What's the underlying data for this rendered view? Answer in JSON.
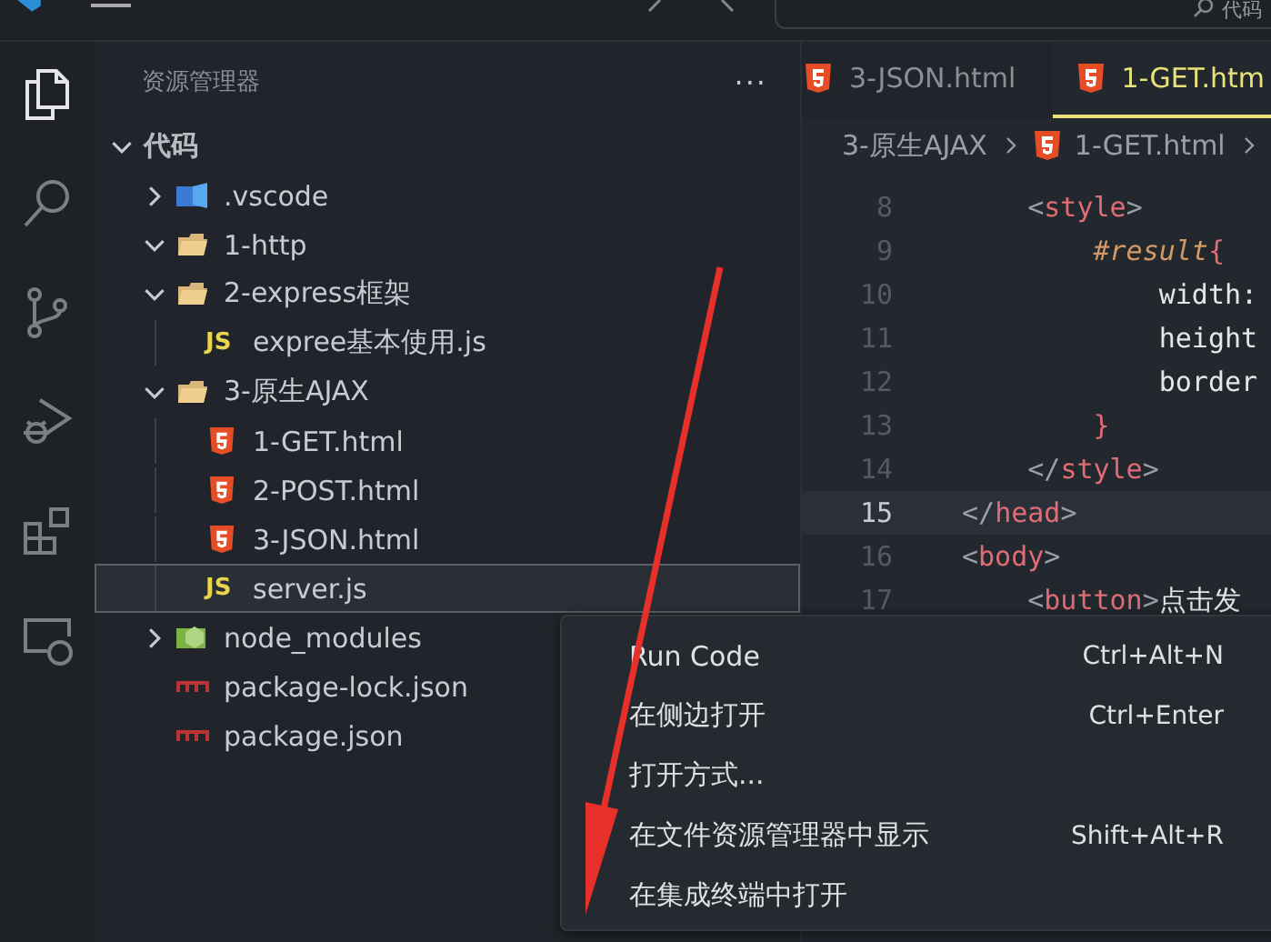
{
  "title_bar": {
    "search_text": "代码"
  },
  "activity_bar": [
    {
      "kind": "files",
      "selected": true
    },
    {
      "kind": "search",
      "selected": false
    },
    {
      "kind": "scm",
      "selected": false
    },
    {
      "kind": "debug",
      "selected": false
    },
    {
      "kind": "extensions",
      "selected": false
    },
    {
      "kind": "remote",
      "selected": false
    }
  ],
  "sidebar": {
    "title": "资源管理器",
    "more": "···",
    "workspace": {
      "label": "代码",
      "expanded": true
    },
    "tree": [
      {
        "name": ".vscode",
        "kind": "vscode-folder",
        "expanded": false,
        "selected": false
      },
      {
        "name": "1-http",
        "kind": "folder",
        "expanded": true,
        "selected": false
      },
      {
        "name": "2-express框架",
        "kind": "folder",
        "expanded": true,
        "selected": false,
        "children": [
          {
            "name": "expree基本使用.js",
            "kind": "js",
            "icon": "JS",
            "selected": false
          }
        ]
      },
      {
        "name": "3-原生AJAX",
        "kind": "folder",
        "expanded": true,
        "selected": false,
        "children": [
          {
            "name": "1-GET.html",
            "kind": "html",
            "selected": false
          },
          {
            "name": "2-POST.html",
            "kind": "html",
            "selected": false
          },
          {
            "name": "3-JSON.html",
            "kind": "html",
            "selected": false
          },
          {
            "name": "server.js",
            "kind": "js",
            "icon": "JS",
            "selected": true
          }
        ]
      },
      {
        "name": "node_modules",
        "kind": "node-folder",
        "expanded": false,
        "selected": false
      },
      {
        "name": "package-lock.json",
        "kind": "npm",
        "selected": false
      },
      {
        "name": "package.json",
        "kind": "npm",
        "selected": false
      }
    ]
  },
  "editor": {
    "tabs": [
      {
        "label": "3-JSON.html",
        "selected": false
      },
      {
        "label": "1-GET.htm",
        "selected": true
      }
    ],
    "breadcrumb": [
      "3-原生AJAX",
      "1-GET.html"
    ],
    "lines": [
      {
        "number": "8",
        "current": false,
        "tokens": [
          {
            "kind": "punct",
            "text": "    <"
          },
          {
            "kind": "tag",
            "text": "style"
          },
          {
            "kind": "punct",
            "text": ">"
          }
        ]
      },
      {
        "number": "9",
        "current": false,
        "tokens": [
          {
            "kind": "selector",
            "text": "        #result"
          },
          {
            "kind": "tag",
            "text": "{"
          }
        ]
      },
      {
        "number": "10",
        "current": false,
        "tokens": [
          {
            "kind": "prop",
            "text": "            width:"
          }
        ]
      },
      {
        "number": "11",
        "current": false,
        "tokens": [
          {
            "kind": "prop",
            "text": "            height"
          }
        ]
      },
      {
        "number": "12",
        "current": false,
        "tokens": [
          {
            "kind": "prop",
            "text": "            border"
          }
        ]
      },
      {
        "number": "13",
        "current": false,
        "tokens": [
          {
            "kind": "tag",
            "text": "        }"
          }
        ]
      },
      {
        "number": "14",
        "current": false,
        "tokens": [
          {
            "kind": "punct",
            "text": "    </"
          },
          {
            "kind": "tag",
            "text": "style"
          },
          {
            "kind": "punct",
            "text": ">"
          }
        ]
      },
      {
        "number": "15",
        "current": true,
        "tokens": [
          {
            "kind": "punct",
            "text": "</"
          },
          {
            "kind": "tag",
            "text": "head"
          },
          {
            "kind": "punct",
            "text": ">"
          }
        ]
      },
      {
        "number": "16",
        "current": false,
        "tokens": [
          {
            "kind": "punct",
            "text": "<"
          },
          {
            "kind": "tag",
            "text": "body"
          },
          {
            "kind": "punct",
            "text": ">"
          }
        ]
      },
      {
        "number": "17",
        "current": false,
        "tokens": [
          {
            "kind": "punct",
            "text": "    <"
          },
          {
            "kind": "tag",
            "text": "button"
          },
          {
            "kind": "punct",
            "text": ">"
          },
          {
            "kind": "prop",
            "text": "点击发"
          }
        ]
      }
    ]
  },
  "context_menu": [
    {
      "label": "Run Code",
      "shortcut": "Ctrl+Alt+N"
    },
    {
      "label": "在侧边打开",
      "shortcut": "Ctrl+Enter"
    },
    {
      "label": "打开方式..."
    },
    {
      "label": "在文件资源管理器中显示",
      "shortcut": "Shift+Alt+R"
    },
    {
      "label": "在集成终端中打开"
    }
  ]
}
